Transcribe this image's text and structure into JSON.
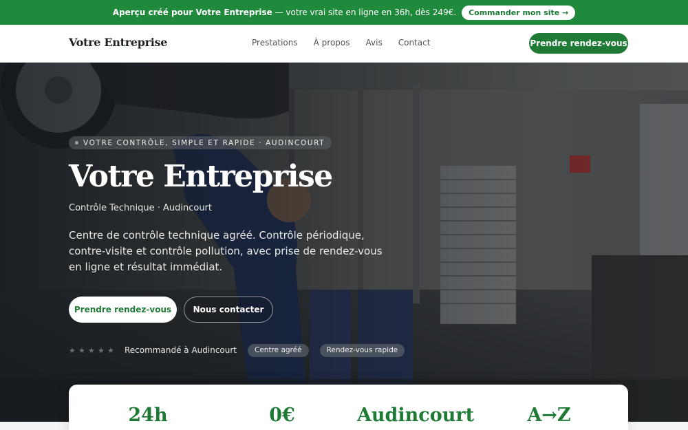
{
  "promo": {
    "brand_bold": "Aperçu créé pour Votre Entreprise",
    "text": "— votre vrai site en ligne en 36h, dès 249€.",
    "button": "Commander mon site →"
  },
  "header": {
    "brand": "Votre Entreprise",
    "nav": [
      "Prestations",
      "À propos",
      "Avis",
      "Contact"
    ],
    "cta": "Prendre rendez-vous"
  },
  "hero": {
    "eyebrow": "VOTRE CONTRÔLE, SIMPLE ET RAPIDE · AUDINCOURT",
    "title": "Votre Entreprise",
    "subtitle": "Contrôle Technique · Audincourt",
    "description": "Centre de contrôle technique agréé. Contrôle périodique, contre-visite et contrôle pollution, avec prise de rendez-vous en ligne et résultat immédiat.",
    "primary_button": "Prendre rendez-vous",
    "secondary_button": "Nous contacter",
    "trust_text": "Recommandé à Audincourt",
    "chips": [
      "Centre agréé",
      "Rendez-vous rapide"
    ]
  },
  "stats": [
    "24h",
    "0€",
    "Audincourt",
    "A→Z"
  ],
  "colors": {
    "accent": "#1f7a36",
    "promo_bg": "#1f8a3b"
  }
}
